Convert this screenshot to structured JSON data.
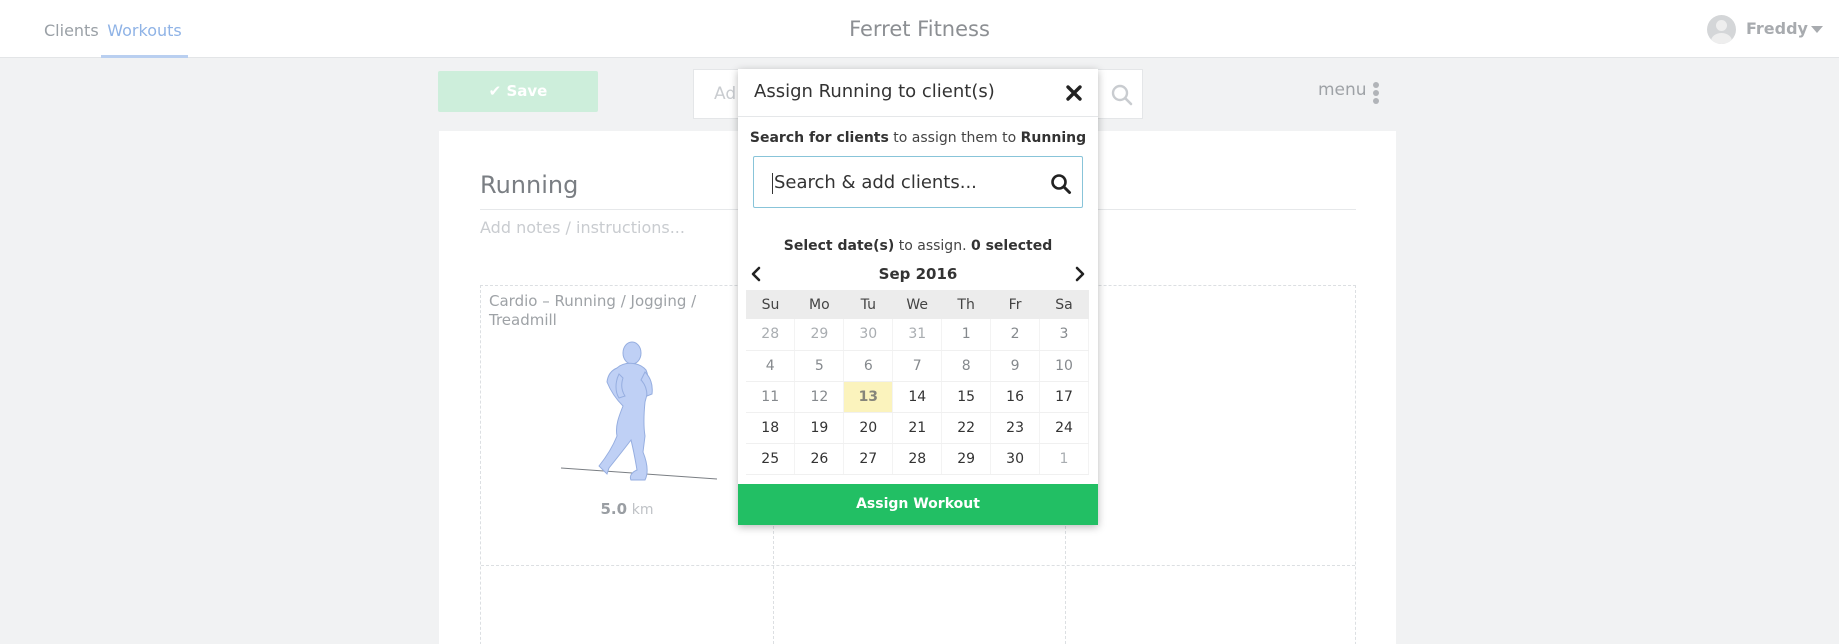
{
  "nav": {
    "tabs": [
      {
        "label": "Clients"
      },
      {
        "label": "Workouts"
      }
    ],
    "brand": "Ferret Fitness",
    "user_name": "Freddy"
  },
  "toolbar": {
    "save_label": "✔ Save",
    "search_placeholder": "Ad",
    "menu_label": "menu"
  },
  "workout": {
    "title": "Running",
    "notes_placeholder": "Add notes / instructions...",
    "exercise": {
      "name": "Cardio – Running / Jogging / Treadmill",
      "distance": "5.0",
      "unit": "km"
    }
  },
  "modal": {
    "title": "Assign Running to client(s)",
    "search_hint": {
      "bold1": "Search for clients",
      "text": " to assign them to ",
      "bold2": "Running"
    },
    "client_search_placeholder": "Search & add clients...",
    "date_hint": {
      "bold1": "Select date(s)",
      "text": " to assign. ",
      "bold2": "0 selected"
    },
    "calendar": {
      "month": "Sep 2016",
      "weekdays": [
        "Su",
        "Mo",
        "Tu",
        "We",
        "Th",
        "Fr",
        "Sa"
      ],
      "weeks": [
        [
          {
            "d": "28",
            "t": "other"
          },
          {
            "d": "29",
            "t": "other"
          },
          {
            "d": "30",
            "t": "other"
          },
          {
            "d": "31",
            "t": "other"
          },
          {
            "d": "1",
            "t": "past"
          },
          {
            "d": "2",
            "t": "past"
          },
          {
            "d": "3",
            "t": "past"
          }
        ],
        [
          {
            "d": "4",
            "t": "past"
          },
          {
            "d": "5",
            "t": "past"
          },
          {
            "d": "6",
            "t": "past"
          },
          {
            "d": "7",
            "t": "past"
          },
          {
            "d": "8",
            "t": "past"
          },
          {
            "d": "9",
            "t": "past"
          },
          {
            "d": "10",
            "t": "past"
          }
        ],
        [
          {
            "d": "11",
            "t": "past"
          },
          {
            "d": "12",
            "t": "past"
          },
          {
            "d": "13",
            "t": "today"
          },
          {
            "d": "14",
            "t": ""
          },
          {
            "d": "15",
            "t": ""
          },
          {
            "d": "16",
            "t": ""
          },
          {
            "d": "17",
            "t": ""
          }
        ],
        [
          {
            "d": "18",
            "t": ""
          },
          {
            "d": "19",
            "t": ""
          },
          {
            "d": "20",
            "t": ""
          },
          {
            "d": "21",
            "t": ""
          },
          {
            "d": "22",
            "t": ""
          },
          {
            "d": "23",
            "t": ""
          },
          {
            "d": "24",
            "t": ""
          }
        ],
        [
          {
            "d": "25",
            "t": ""
          },
          {
            "d": "26",
            "t": ""
          },
          {
            "d": "27",
            "t": ""
          },
          {
            "d": "28",
            "t": ""
          },
          {
            "d": "29",
            "t": ""
          },
          {
            "d": "30",
            "t": ""
          },
          {
            "d": "1",
            "t": "other"
          }
        ]
      ]
    },
    "assign_label": "Assign Workout"
  }
}
